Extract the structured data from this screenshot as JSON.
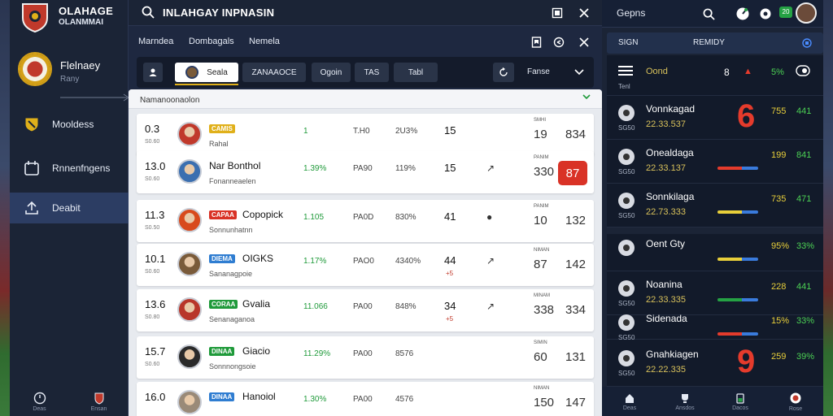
{
  "app": {
    "title": "OLAHAGE",
    "subtitle": "OLANMMAI"
  },
  "profile": {
    "name": "Flelnaey",
    "sub": "Rany"
  },
  "sidebar": {
    "items": [
      {
        "label": "Mooldess"
      },
      {
        "label": "Rnnenfngens"
      },
      {
        "label": "Deabit"
      }
    ],
    "bottom": [
      {
        "label": "Deas"
      },
      {
        "label": "Ensan"
      }
    ]
  },
  "search": {
    "text": "INLAHGAY INPNASIN"
  },
  "subnav": {
    "tabs": [
      "Marndea",
      "Dombagals",
      "Nemela"
    ]
  },
  "filters": {
    "active": "Seala",
    "chips": [
      "ZANAAOCE",
      "Ogoin",
      "TAS",
      "Tabl"
    ],
    "sort_label": "Fanse"
  },
  "list": {
    "header": "Namanoonaolon",
    "rows": [
      {
        "rank": "0.3",
        "rank_sub": "S0.60",
        "badge": "CAMIS",
        "badge_color": "#e0b01a",
        "name": "",
        "pos": "Rahal",
        "s1": "1",
        "s2": "T.H0",
        "s3": "2U3%",
        "s4": "15",
        "s4sub": "",
        "trend": "",
        "lbl": "SMHI",
        "v1": "19",
        "v1c": "green",
        "v2": "834",
        "v2c": "green",
        "hilite": ""
      },
      {
        "rank": "13.0",
        "rank_sub": "S0.60",
        "badge": "",
        "badge_color": "",
        "name": "Nar Bonthol",
        "pos": "Fonanneaelen",
        "s1": "1.39%",
        "s2": "PA90",
        "s3": "119%",
        "s4": "15",
        "s4sub": "",
        "trend": "↗",
        "lbl": "PANIM",
        "v1": "330",
        "v1c": "dark",
        "v2": "",
        "v2c": "",
        "hilite": "87"
      },
      {
        "rank": "11.3",
        "rank_sub": "S0.50",
        "badge": "CAPAA",
        "badge_color": "#d93226",
        "name": "Copopick",
        "pos": "Sonnunhatnn",
        "s1": "1.105",
        "s2": "PA0D",
        "s3": "830%",
        "s4": "41",
        "s4sub": "",
        "trend": "●",
        "lbl": "PANIM",
        "v1": "10",
        "v1c": "red",
        "v2": "132",
        "v2c": "red",
        "hilite": ""
      },
      {
        "rank": "10.1",
        "rank_sub": "S0.60",
        "badge": "DIEMA",
        "badge_color": "#2f7dd1",
        "name": "OIGKS",
        "pos": "Sananagpoie",
        "s1": "1.17%",
        "s2": "PAO0",
        "s3": "4340%",
        "s4": "44",
        "s4sub": "+5",
        "trend": "↗",
        "lbl": "NIMAN",
        "v1": "87",
        "v1c": "green",
        "v2": "142",
        "v2c": "red",
        "hilite": ""
      },
      {
        "rank": "13.6",
        "rank_sub": "S0.80",
        "badge": "CORAA",
        "badge_color": "#1f9a3a",
        "name": "Gvalia",
        "pos": "Senanaganoa",
        "s1": "11.066",
        "s2": "PA00",
        "s3": "848%",
        "s4": "34",
        "s4sub": "+5",
        "trend": "↗",
        "lbl": "MINAM",
        "v1": "338",
        "v1c": "green",
        "v2": "334",
        "v2c": "green",
        "hilite": ""
      },
      {
        "rank": "15.7",
        "rank_sub": "S0.60",
        "badge": "DINAA",
        "badge_color": "#1f9a3a",
        "name": "Giacio",
        "pos": "Sonnnongsoie",
        "s1": "11.29%",
        "s2": "PA00",
        "s3": "8576",
        "s4": "",
        "s4sub": "",
        "trend": "",
        "lbl": "SIMIN",
        "v1": "60",
        "v1c": "dark",
        "v2": "131",
        "v2c": "green",
        "hilite": ""
      },
      {
        "rank": "16.0",
        "rank_sub": "",
        "badge": "DINAA",
        "badge_color": "#2f7dd1",
        "name": "Hanoiol",
        "pos": "",
        "s1": "1.30%",
        "s2": "PA00",
        "s3": "4576",
        "s4": "",
        "s4sub": "",
        "trend": "",
        "lbl": "NIMAN",
        "v1": "150",
        "v1c": "dark",
        "v2": "147",
        "v2c": "dark",
        "hilite": ""
      }
    ]
  },
  "right": {
    "top_label": "Gepns",
    "badge": "20",
    "head": {
      "left": "SIGN",
      "mid": "REMIDY"
    },
    "rows": [
      {
        "small": "Tenl",
        "name": "",
        "sub": "Oond",
        "big": "",
        "a": "5%",
        "b": "",
        "extra": "8"
      },
      {
        "small": "SG50",
        "name": "Vonnkagad",
        "sub": "22.33.537",
        "big": "6",
        "a": "755",
        "b": "441"
      },
      {
        "small": "SG50",
        "name": "Onealdaga",
        "sub": "22.33.137",
        "big": "",
        "a": "199",
        "b": "841"
      },
      {
        "small": "SG50",
        "name": "Sonnkilaga",
        "sub": "22.73.333",
        "big": "",
        "a": "735",
        "b": "471"
      },
      {
        "small": "",
        "name": "Oent Gty",
        "sub": "",
        "big": "",
        "a": "95%",
        "b": "33%"
      },
      {
        "small": "SG50",
        "name": "Noanina",
        "sub": "22.33.335",
        "big": "",
        "a": "228",
        "b": "441"
      },
      {
        "small": "SG50",
        "name": "Sidenada",
        "sub": "",
        "big": "",
        "a": "15%",
        "b": "33%"
      },
      {
        "small": "SG50",
        "name": "Gnahkiagen",
        "sub": "22.22.335",
        "big": "9",
        "a": "259",
        "b": "39%"
      }
    ],
    "bottom": [
      {
        "label": "Deas"
      },
      {
        "label": "Ansdos"
      },
      {
        "label": "Dacos"
      },
      {
        "label": "Rose"
      }
    ]
  }
}
